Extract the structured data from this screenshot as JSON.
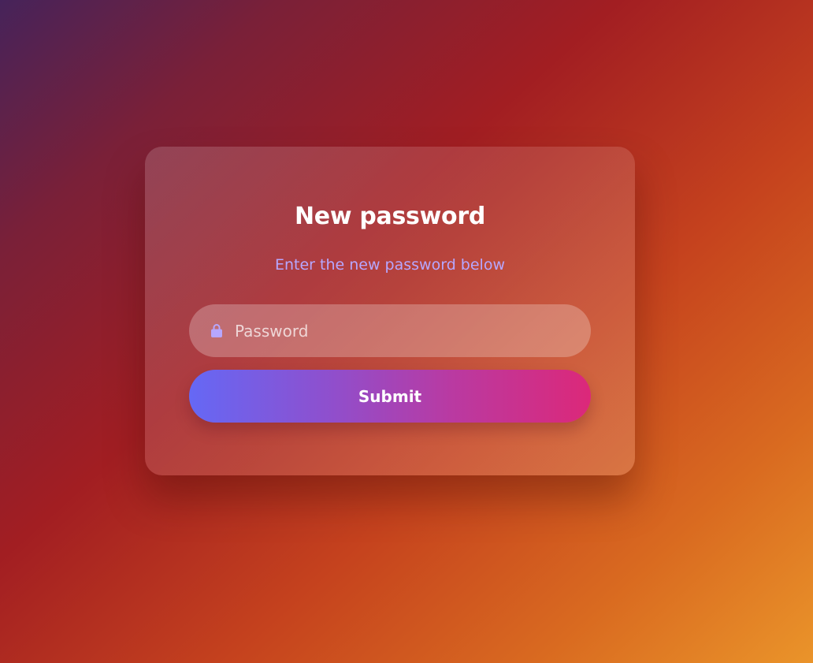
{
  "form": {
    "title": "New password",
    "subtitle": "Enter the new password below",
    "password_field": {
      "placeholder": "Password",
      "value": "",
      "icon": "lock-icon"
    },
    "submit_label": "Submit"
  },
  "colors": {
    "subtitle": "#b6a7ff",
    "lock_icon": "#b6a7ff",
    "button_gradient_start": "#6568f5",
    "button_gradient_end": "#dc2879",
    "background_top_left": "#46235a",
    "background_bottom_right": "#ea942a"
  }
}
